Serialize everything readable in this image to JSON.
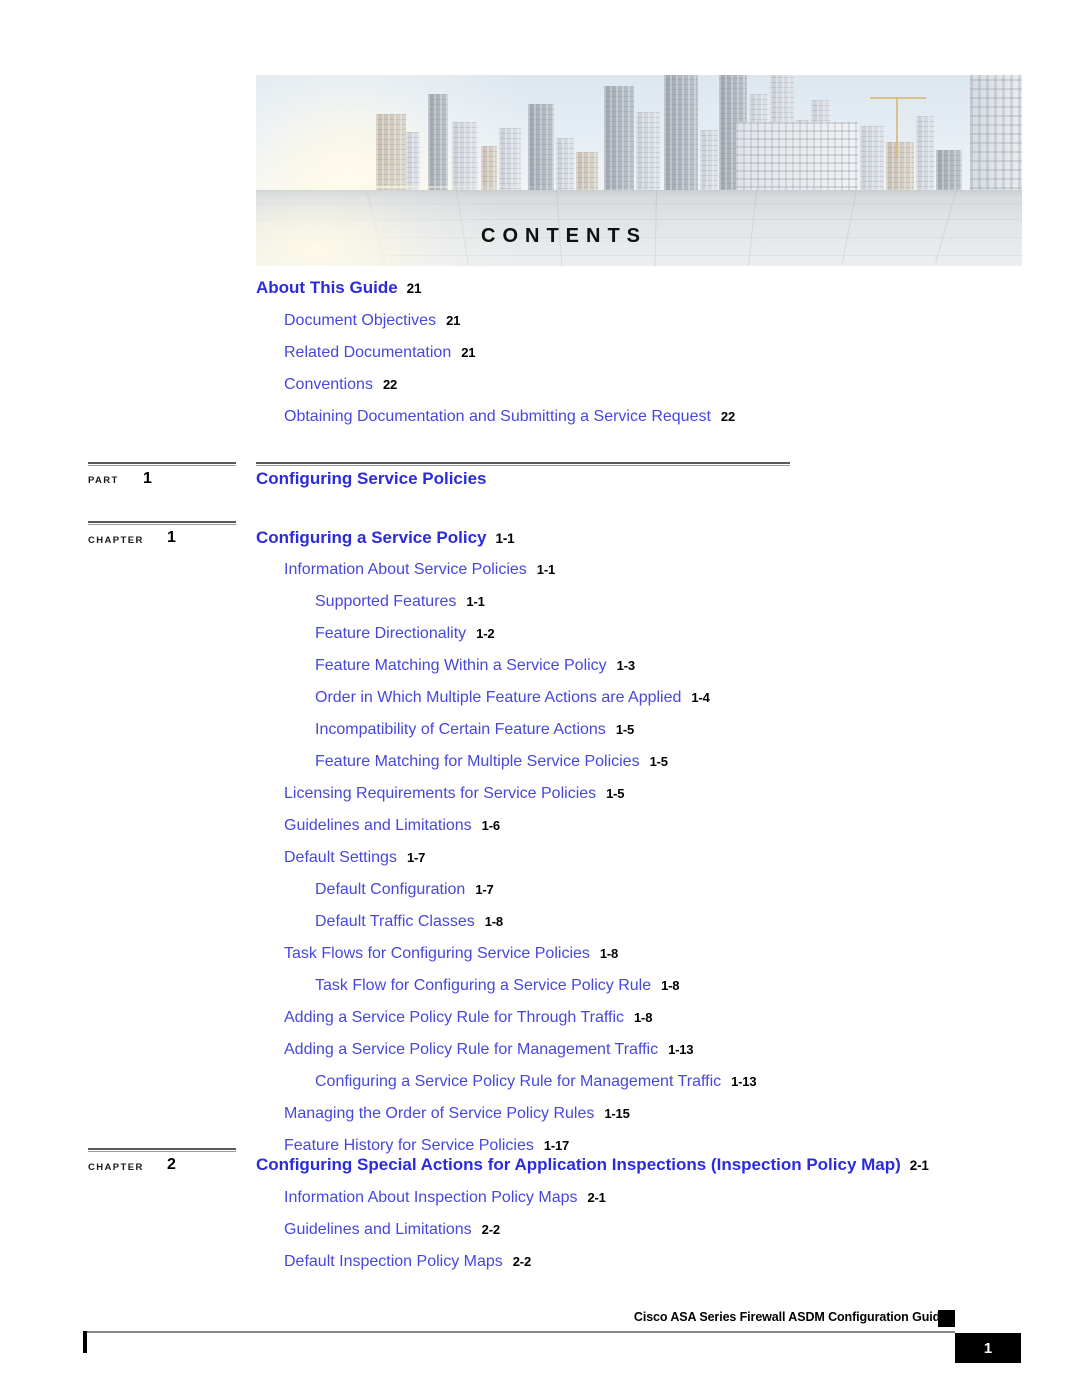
{
  "header": {
    "banner_title": "CONTENTS",
    "banner_image": "cityscape-photo"
  },
  "toc": {
    "front_matter": {
      "title": "About This Guide",
      "page": "21",
      "items": [
        {
          "label": "Document Objectives",
          "page": "21",
          "level": 2
        },
        {
          "label": "Related Documentation",
          "page": "21",
          "level": 2
        },
        {
          "label": "Conventions",
          "page": "22",
          "level": 2
        },
        {
          "label": "Obtaining Documentation and Submitting a Service Request",
          "page": "22",
          "level": 2
        }
      ]
    },
    "part": {
      "marker_label": "PART",
      "marker_number": "1",
      "title": "Configuring Service Policies"
    },
    "chapters": [
      {
        "marker_label": "CHAPTER",
        "marker_number": "1",
        "title": "Configuring a Service Policy",
        "page": "1-1",
        "items": [
          {
            "label": "Information About Service Policies",
            "page": "1-1",
            "level": 2
          },
          {
            "label": "Supported Features",
            "page": "1-1",
            "level": 3
          },
          {
            "label": "Feature Directionality",
            "page": "1-2",
            "level": 3
          },
          {
            "label": "Feature Matching Within a Service Policy",
            "page": "1-3",
            "level": 3
          },
          {
            "label": "Order in Which Multiple Feature Actions are Applied",
            "page": "1-4",
            "level": 3
          },
          {
            "label": "Incompatibility of Certain Feature Actions",
            "page": "1-5",
            "level": 3
          },
          {
            "label": "Feature Matching for Multiple Service Policies",
            "page": "1-5",
            "level": 3
          },
          {
            "label": "Licensing Requirements for Service Policies",
            "page": "1-5",
            "level": 2
          },
          {
            "label": "Guidelines and Limitations",
            "page": "1-6",
            "level": 2
          },
          {
            "label": "Default Settings",
            "page": "1-7",
            "level": 2
          },
          {
            "label": "Default Configuration",
            "page": "1-7",
            "level": 3
          },
          {
            "label": "Default Traffic Classes",
            "page": "1-8",
            "level": 3
          },
          {
            "label": "Task Flows for Configuring Service Policies",
            "page": "1-8",
            "level": 2
          },
          {
            "label": "Task Flow for Configuring a Service Policy Rule",
            "page": "1-8",
            "level": 3
          },
          {
            "label": "Adding a Service Policy Rule for Through Traffic",
            "page": "1-8",
            "level": 2
          },
          {
            "label": "Adding a Service Policy Rule for Management Traffic",
            "page": "1-13",
            "level": 2
          },
          {
            "label": "Configuring a Service Policy Rule for Management Traffic",
            "page": "1-13",
            "level": 3
          },
          {
            "label": "Managing the Order of Service Policy Rules",
            "page": "1-15",
            "level": 2
          },
          {
            "label": "Feature History for Service Policies",
            "page": "1-17",
            "level": 2
          }
        ]
      },
      {
        "marker_label": "CHAPTER",
        "marker_number": "2",
        "title": "Configuring Special Actions for Application Inspections (Inspection Policy Map)",
        "page": "2-1",
        "items": [
          {
            "label": "Information About Inspection Policy Maps",
            "page": "2-1",
            "level": 2
          },
          {
            "label": "Guidelines and Limitations",
            "page": "2-2",
            "level": 2
          },
          {
            "label": "Default Inspection Policy Maps",
            "page": "2-2",
            "level": 2
          }
        ]
      }
    ]
  },
  "footer": {
    "guide_title": "Cisco ASA Series Firewall ASDM Configuration Guide",
    "page_number": "1"
  },
  "colors": {
    "link_blue": "#4747dd",
    "heading_blue": "#2b2bdc",
    "page_number_black": "#000000",
    "rule_gray": "#58585a"
  }
}
